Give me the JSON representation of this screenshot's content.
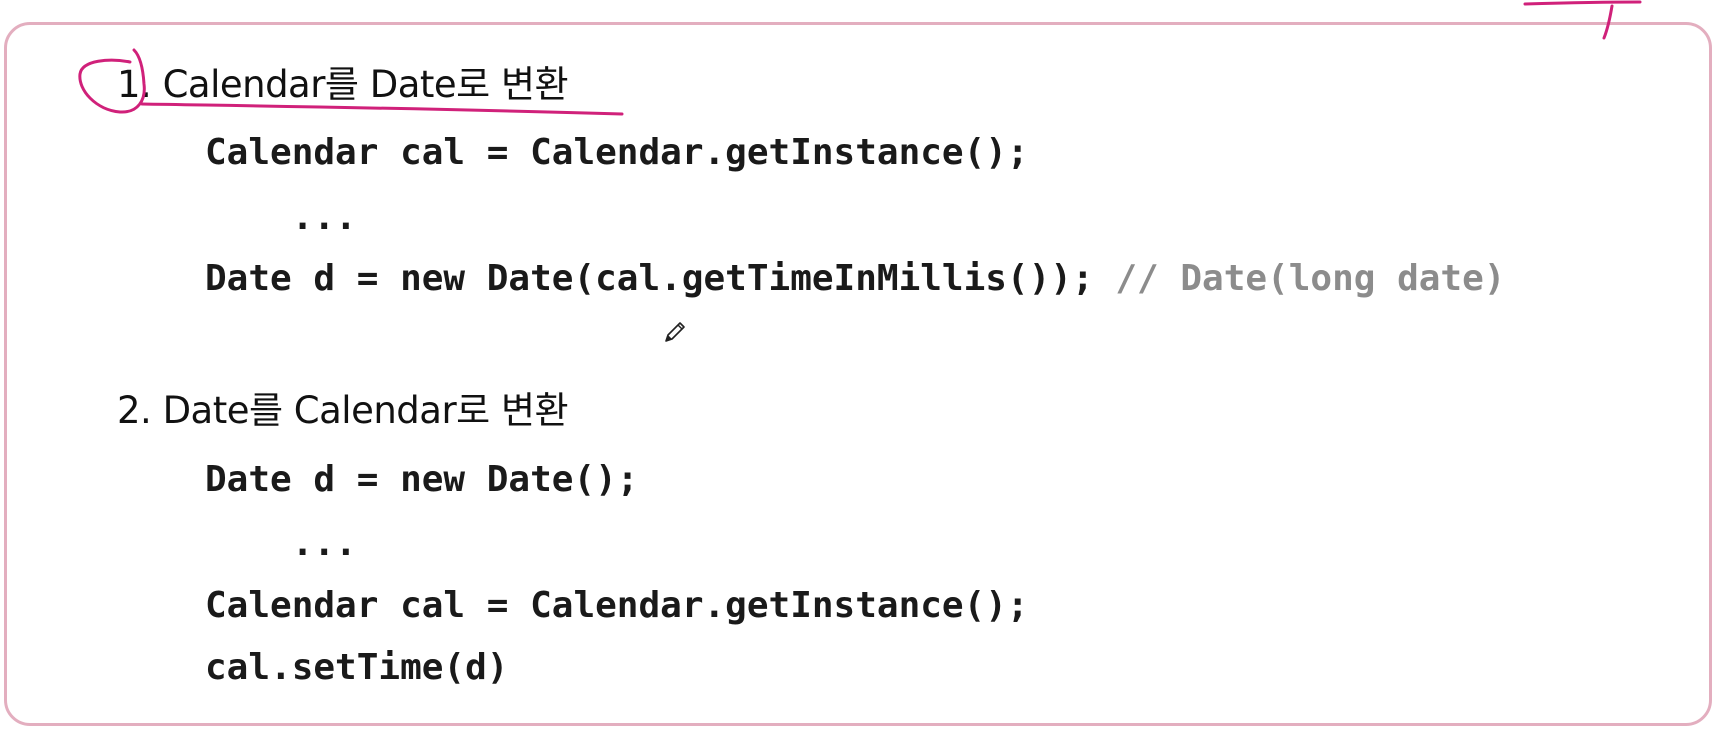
{
  "section1": {
    "heading": "1. Calendar를 Date로 변환",
    "code": [
      "Calendar cal = Calendar.getInstance();",
      "    ...",
      "Date d = new Date(cal.getTimeInMillis());"
    ],
    "comment": "// Date(long date)"
  },
  "section2": {
    "heading": "2. Date를 Calendar로 변환",
    "code": [
      "Date d = new Date();",
      "    ...",
      "Calendar cal = Calendar.getInstance();",
      "cal.setTime(d)"
    ]
  },
  "annotation_color": "#d0217a",
  "frame_color": "#e3aebf",
  "icons": {
    "cursor": "pencil-cursor-icon"
  }
}
